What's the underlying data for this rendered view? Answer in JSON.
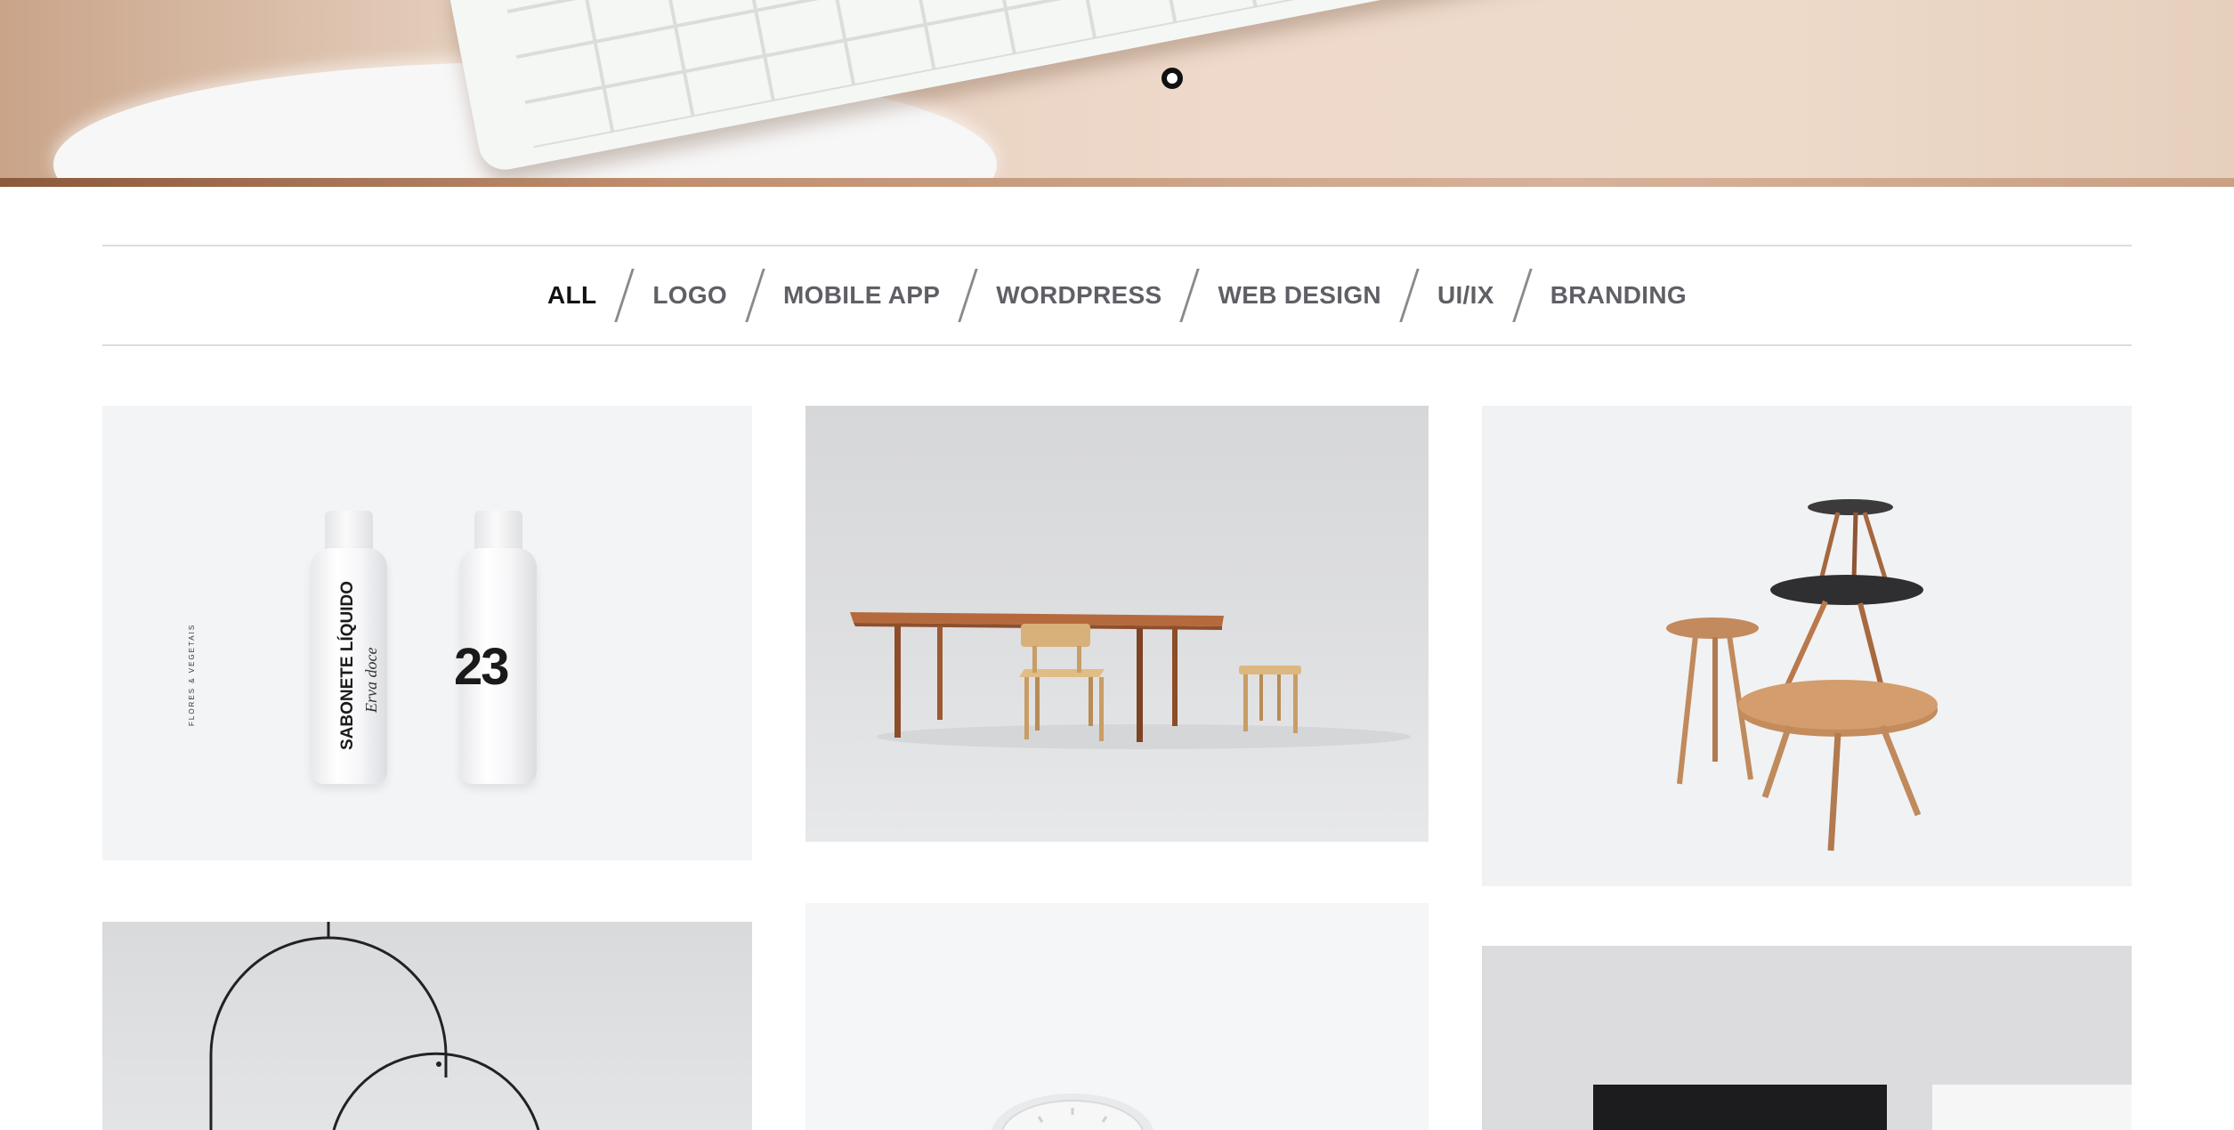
{
  "hero": {
    "slider_dots": 1
  },
  "filter": {
    "items": [
      {
        "label": "ALL",
        "active": true
      },
      {
        "label": "LOGO",
        "active": false
      },
      {
        "label": "MOBILE APP",
        "active": false
      },
      {
        "label": "WORDPRESS",
        "active": false
      },
      {
        "label": "WEB DESIGN",
        "active": false
      },
      {
        "label": "UI/IX",
        "active": false
      },
      {
        "label": "BRANDING",
        "active": false
      }
    ]
  },
  "gallery": {
    "bottle_brand_small": "FLORES & VEGETAIS",
    "bottle_label": "SABONETE LÍQUIDO",
    "bottle_script": "Erva doce",
    "bottle_number": "23"
  }
}
